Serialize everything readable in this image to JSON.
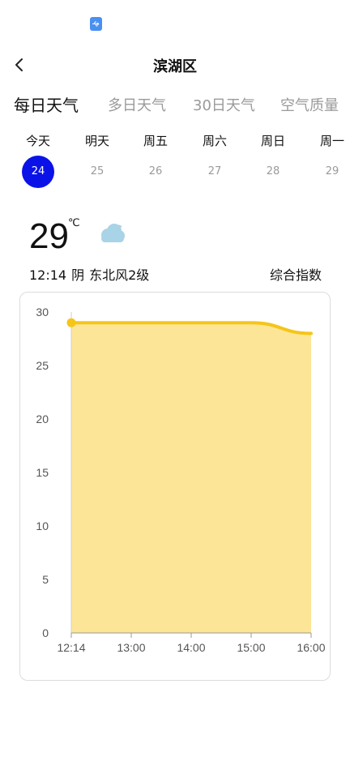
{
  "status_bar": {
    "icon": "usb-icon"
  },
  "header": {
    "title": "滨湖区",
    "back_icon": "chevron-left-icon"
  },
  "main_tabs": [
    {
      "label": "每日天气",
      "active": true
    },
    {
      "label": "多日天气",
      "active": false
    },
    {
      "label": "30日天气",
      "active": false
    },
    {
      "label": "空气质量",
      "active": false
    }
  ],
  "days": [
    {
      "label": "今天",
      "date": "24",
      "selected": true
    },
    {
      "label": "明天",
      "date": "25",
      "selected": false
    },
    {
      "label": "周五",
      "date": "26",
      "selected": false
    },
    {
      "label": "周六",
      "date": "27",
      "selected": false
    },
    {
      "label": "周日",
      "date": "28",
      "selected": false
    },
    {
      "label": "周一",
      "date": "29",
      "selected": false
    }
  ],
  "current": {
    "temperature": "29",
    "unit": "℃",
    "weather_icon": "cloud-icon",
    "time": "12:14",
    "condition": "阴",
    "wind": "东北风2级",
    "index_label": "综合指数"
  },
  "colors": {
    "accent": "#0a12e8",
    "line": "#f5c518",
    "fill": "#fde597",
    "cloud": "#a9d3e6"
  },
  "chart_data": {
    "type": "area",
    "x": [
      "12:14",
      "13:00",
      "14:00",
      "15:00",
      "16:00"
    ],
    "values": [
      29,
      29,
      29,
      29,
      28
    ],
    "xlabel": "",
    "ylabel": "",
    "ylim": [
      0,
      30
    ],
    "yticks": [
      0,
      5,
      10,
      15,
      20,
      25,
      30
    ],
    "grid": false,
    "legend": "none"
  }
}
